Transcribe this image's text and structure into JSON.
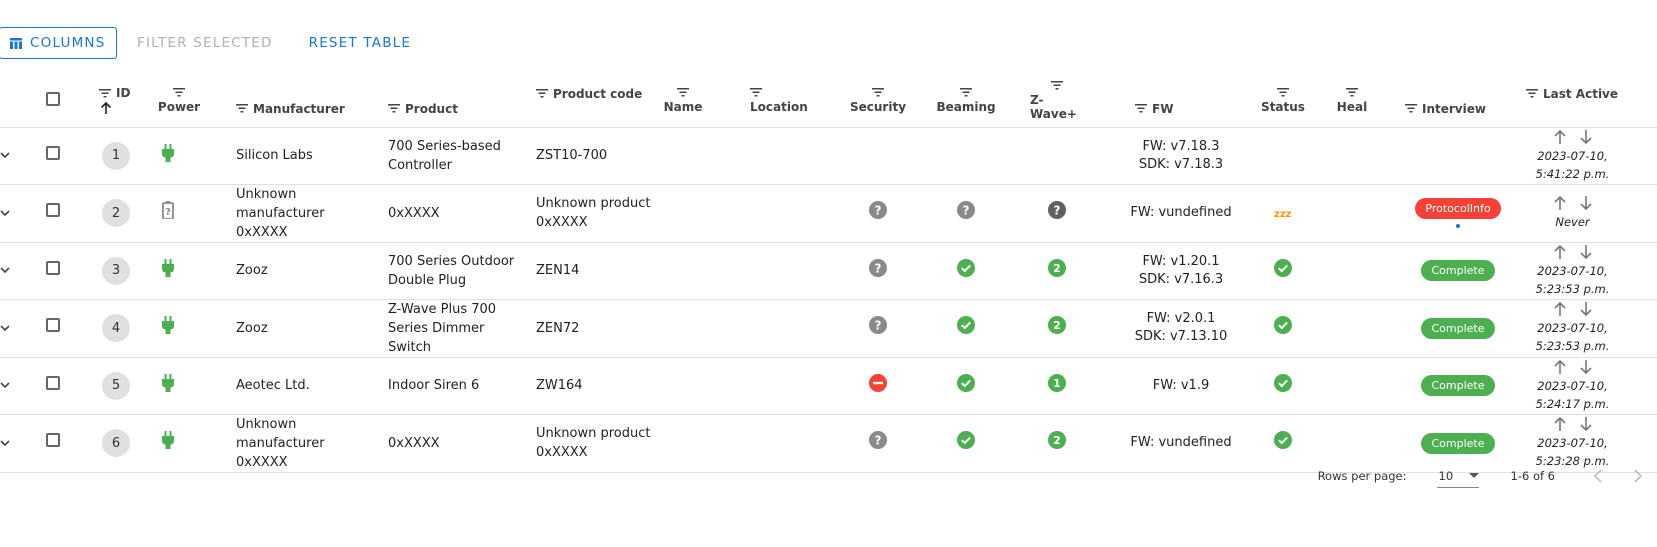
{
  "toolbar": {
    "columns_label": "COLUMNS",
    "filter_label": "FILTER SELECTED",
    "reset_label": "RESET TABLE"
  },
  "headers": {
    "id": "ID",
    "power": "Power",
    "manufacturer": "Manufacturer",
    "product": "Product",
    "product_code": "Product code",
    "name": "Name",
    "location": "Location",
    "security": "Security",
    "beaming": "Beaming",
    "zwave_plus": "Z-Wave+",
    "fw": "FW",
    "status": "Status",
    "heal": "Heal",
    "interview": "Interview",
    "last_active": "Last Active"
  },
  "rows": [
    {
      "id": "1",
      "power": "mains",
      "manufacturer": "Silicon Labs",
      "product": "700 Series-based Controller",
      "product_code": "ZST10-700",
      "security": "",
      "beaming": "",
      "zwave_plus": "",
      "fw_line1": "FW: v7.18.3",
      "fw_line2": "SDK: v7.18.3",
      "status": "",
      "interview": "",
      "last_active_line1": "2023-07-10,",
      "last_active_line2": "5:41:22 p.m."
    },
    {
      "id": "2",
      "power": "battery",
      "manufacturer": "Unknown manufacturer 0xXXXX",
      "product": "0xXXXX",
      "product_code": "Unknown product 0xXXXX",
      "security": "unknown",
      "beaming": "unknown",
      "zwave_plus": "unknown",
      "fw_line1": "FW: vundefined",
      "fw_line2": "",
      "status": "asleep",
      "status_text": "zzz",
      "interview": "ProtocolInfo",
      "interview_state": "error",
      "last_active_line1": "Never",
      "last_active_line2": ""
    },
    {
      "id": "3",
      "power": "mains",
      "manufacturer": "Zooz",
      "product": "700 Series Outdoor Double Plug",
      "product_code": "ZEN14",
      "security": "unknown",
      "beaming": "yes",
      "zwave_plus": "2",
      "fw_line1": "FW: v1.20.1",
      "fw_line2": "SDK: v7.16.3",
      "status": "alive",
      "interview": "Complete",
      "interview_state": "complete",
      "last_active_line1": "2023-07-10,",
      "last_active_line2": "5:23:53 p.m."
    },
    {
      "id": "4",
      "power": "mains",
      "manufacturer": "Zooz",
      "product": "Z-Wave Plus 700 Series Dimmer Switch",
      "product_code": "ZEN72",
      "security": "unknown",
      "beaming": "yes",
      "zwave_plus": "2",
      "fw_line1": "FW: v2.0.1",
      "fw_line2": "SDK: v7.13.10",
      "status": "alive",
      "interview": "Complete",
      "interview_state": "complete",
      "last_active_line1": "2023-07-10,",
      "last_active_line2": "5:23:53 p.m."
    },
    {
      "id": "5",
      "power": "mains",
      "manufacturer": "Aeotec Ltd.",
      "product": "Indoor Siren 6",
      "product_code": "ZW164",
      "security": "insecure",
      "beaming": "yes",
      "zwave_plus": "1",
      "fw_line1": "FW: v1.9",
      "fw_line2": "",
      "status": "alive",
      "interview": "Complete",
      "interview_state": "complete",
      "last_active_line1": "2023-07-10,",
      "last_active_line2": "5:24:17 p.m."
    },
    {
      "id": "6",
      "power": "mains",
      "manufacturer": "Unknown manufacturer 0xXXXX",
      "product": "0xXXXX",
      "product_code": "Unknown product 0xXXXX",
      "security": "unknown",
      "beaming": "yes",
      "zwave_plus": "2",
      "fw_line1": "FW: vundefined",
      "fw_line2": "",
      "status": "alive",
      "interview": "Complete",
      "interview_state": "complete",
      "last_active_line1": "2023-07-10,",
      "last_active_line2": "5:23:28 p.m."
    }
  ],
  "footer": {
    "rows_per_page_label": "Rows per page:",
    "rows_per_page_value": "10",
    "range": "1-6 of 6"
  },
  "colors": {
    "primary": "#1976d2",
    "success": "#4caf50",
    "error": "#f44336",
    "unknown": "#8a8a8a",
    "sleep": "#ff9800"
  },
  "icons": {
    "columns": "view-column-icon",
    "filter": "filter-icon",
    "sort": "arrow-up-icon",
    "expand": "chevron-down-icon",
    "power_mains": "plug-icon",
    "power_battery": "battery-icon",
    "unknown": "help-circle-icon",
    "check": "check-circle-icon",
    "insecure": "minus-circle-icon",
    "sleep": "sleep-icon",
    "ping": "arrow-up-icon",
    "refresh": "arrow-down-icon",
    "prev": "chevron-left-icon",
    "next": "chevron-right-icon"
  }
}
